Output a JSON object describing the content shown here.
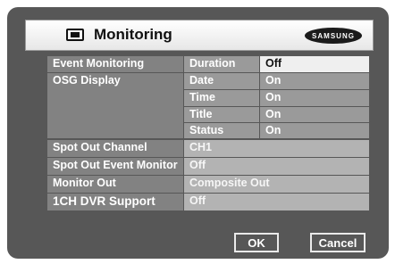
{
  "window": {
    "title": "Monitoring",
    "brand": "SAMSUNG"
  },
  "settings": {
    "event_monitoring": {
      "label": "Event Monitoring",
      "sub_label": "Duration",
      "value": "Off"
    },
    "osd_display": {
      "label": "OSG Display",
      "items": [
        {
          "label": "Date",
          "value": "On"
        },
        {
          "label": "Time",
          "value": "On"
        },
        {
          "label": "Title",
          "value": "On"
        },
        {
          "label": "Status",
          "value": "On"
        }
      ]
    },
    "spot_out_channel": {
      "label": "Spot Out Channel",
      "value": "CH1"
    },
    "spot_out_event_monitor": {
      "label": "Spot Out Event Monitor",
      "value": "Off"
    },
    "monitor_out": {
      "label": "Monitor Out",
      "value": "Composite Out"
    },
    "dvr_support": {
      "label": "1CH DVR Support",
      "value": "Off"
    }
  },
  "buttons": {
    "ok_label": "OK",
    "cancel_label": "Cancel"
  }
}
